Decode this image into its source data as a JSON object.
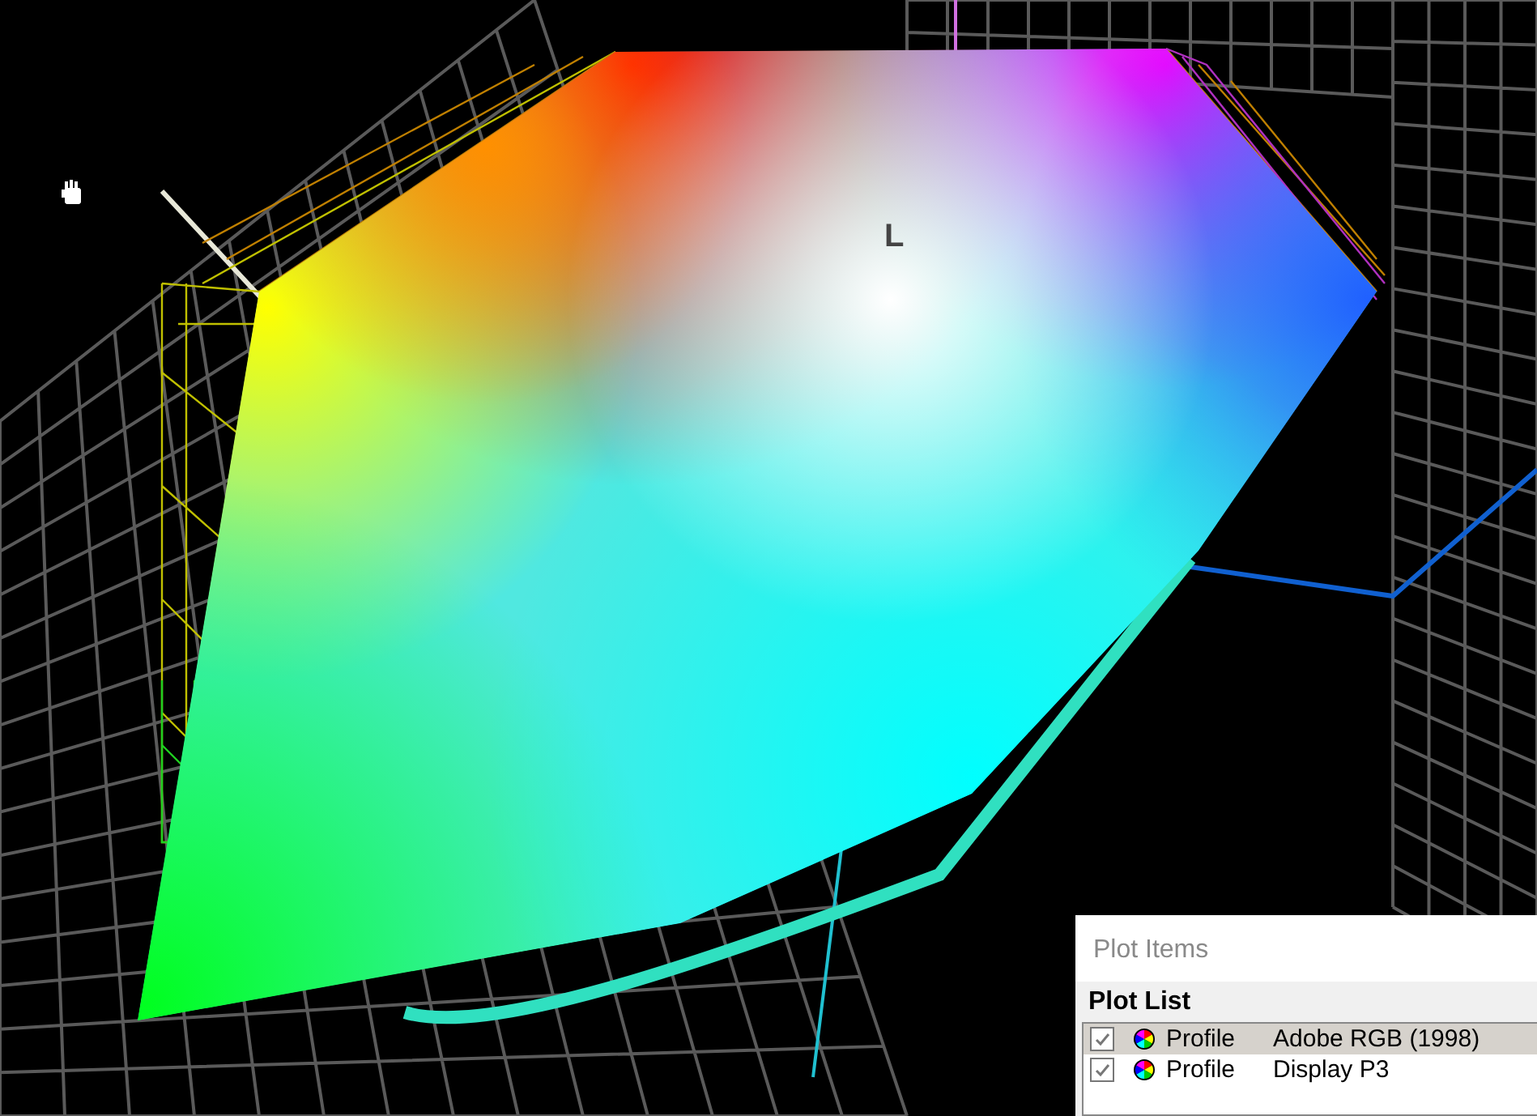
{
  "plot_label": "L",
  "panel": {
    "title": "Plot Items",
    "list_title": "Plot List",
    "items": [
      {
        "type": "Profile",
        "name": "Adobe RGB (1998)",
        "checked": true,
        "selected": true
      },
      {
        "type": "Profile",
        "name": "Display P3",
        "checked": true,
        "selected": false
      }
    ]
  }
}
